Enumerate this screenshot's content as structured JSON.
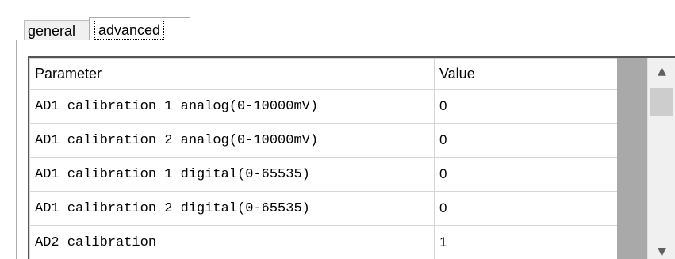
{
  "tabs": [
    {
      "label": "general",
      "active": false
    },
    {
      "label": "advanced",
      "active": true
    }
  ],
  "grid": {
    "columns": [
      "Parameter",
      "Value"
    ],
    "rows": [
      {
        "parameter": "AD1 calibration 1 analog(0-10000mV)",
        "value": "0"
      },
      {
        "parameter": "AD1 calibration 2 analog(0-10000mV)",
        "value": "0"
      },
      {
        "parameter": "AD1 calibration 1 digital(0-65535)",
        "value": "0"
      },
      {
        "parameter": "AD1 calibration 2 digital(0-65535)",
        "value": "0"
      },
      {
        "parameter": "AD2 calibration",
        "value": "1"
      }
    ]
  },
  "scrollbar": {
    "up_icon": "chevron-up-icon",
    "down_icon": "chevron-down-icon"
  }
}
